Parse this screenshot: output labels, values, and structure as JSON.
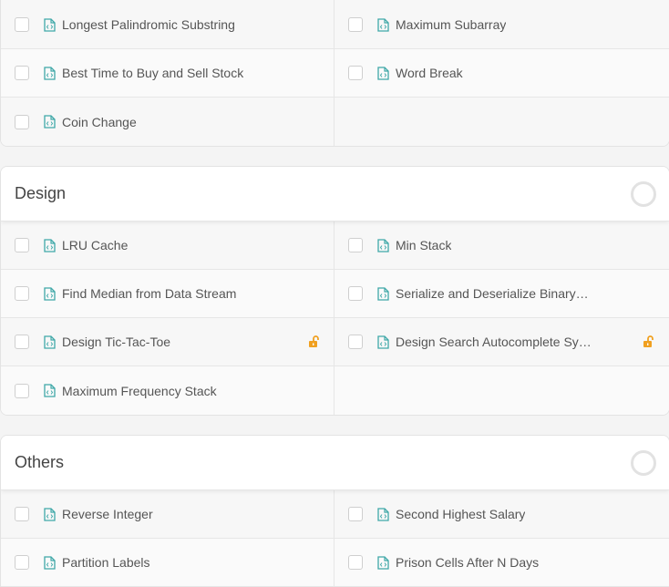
{
  "colors": {
    "icon_teal": "#3fa8a8",
    "lock_orange": "#f0a020",
    "card_bg": "#ffffff",
    "row_bg": "#f7f7f7"
  },
  "sections": [
    {
      "title": "",
      "show_header": false,
      "rows": [
        [
          "Longest Palindromic Substring",
          "Maximum Subarray"
        ],
        [
          "Best Time to Buy and Sell Stock",
          "Word Break"
        ],
        [
          "Coin Change",
          ""
        ]
      ]
    },
    {
      "title": "Design",
      "show_header": true,
      "rows": [
        [
          "LRU Cache",
          "Min Stack"
        ],
        [
          "Find Median from Data Stream",
          "Serialize and Deserialize Binary …"
        ],
        [
          "Design Tic-Tac-Toe",
          "Design Search Autocomplete Sy…"
        ],
        [
          "Maximum Frequency Stack",
          ""
        ]
      ]
    },
    {
      "title": "Others",
      "show_header": true,
      "rows": [
        [
          "Reverse Integer",
          "Second Highest Salary"
        ],
        [
          "Partition Labels",
          "Prison Cells After N Days"
        ]
      ]
    }
  ],
  "locked": [
    "Design Tic-Tac-Toe",
    "Design Search Autocomplete Sy…"
  ],
  "icons": {
    "problem": "code-file-icon",
    "locked": "unlock-icon",
    "progress": "progress-ring-icon"
  }
}
